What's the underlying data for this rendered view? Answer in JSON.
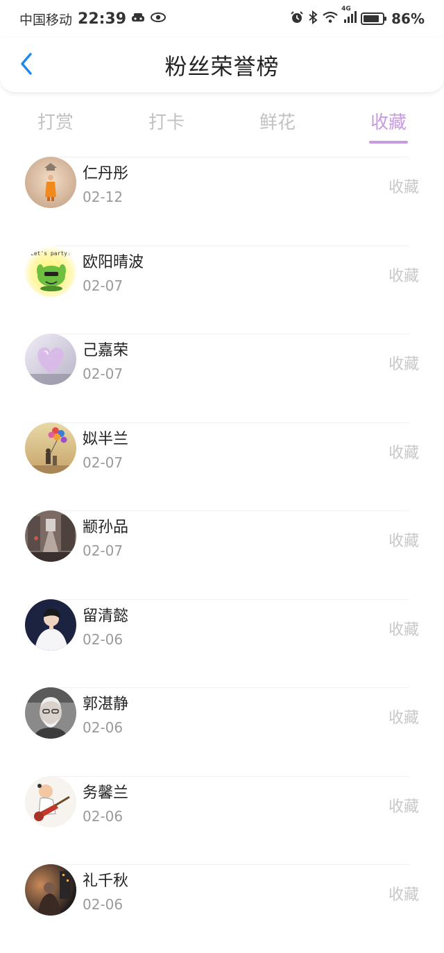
{
  "status_bar": {
    "carrier": "中国移动",
    "time": "22:39",
    "network": "4G",
    "battery_percent": "86%",
    "battery_level": 0.86,
    "icons": [
      "car-icon",
      "eye-icon",
      "alarm-icon",
      "bluetooth-icon",
      "wifi-icon",
      "signal-icon",
      "battery-icon"
    ]
  },
  "header": {
    "title": "粉丝荣誉榜",
    "back_icon": "chevron-left-icon"
  },
  "colors": {
    "accent": "#c79ae3",
    "back_arrow": "#1e88e5",
    "inactive_tab": "#c2c2c2"
  },
  "tabs": [
    {
      "label": "打赏",
      "active": false
    },
    {
      "label": "打卡",
      "active": false
    },
    {
      "label": "鲜花",
      "active": false
    },
    {
      "label": "收藏",
      "active": true
    }
  ],
  "fans": [
    {
      "name": "仁丹彤",
      "date": "02-12",
      "action": "收藏",
      "avatar": "monk-avatar"
    },
    {
      "name": "欧阳晴波",
      "date": "02-07",
      "action": "收藏",
      "avatar": "party-cactus-avatar"
    },
    {
      "name": "己嘉荣",
      "date": "02-07",
      "action": "收藏",
      "avatar": "glass-heart-avatar"
    },
    {
      "name": "姒半兰",
      "date": "02-07",
      "action": "收藏",
      "avatar": "balloons-avatar"
    },
    {
      "name": "颛孙品",
      "date": "02-07",
      "action": "收藏",
      "avatar": "street-avatar"
    },
    {
      "name": "留清懿",
      "date": "02-06",
      "action": "收藏",
      "avatar": "boy-portrait-avatar"
    },
    {
      "name": "郭湛静",
      "date": "02-06",
      "action": "收藏",
      "avatar": "old-man-avatar"
    },
    {
      "name": "务馨兰",
      "date": "02-06",
      "action": "收藏",
      "avatar": "cartoon-guitar-avatar"
    },
    {
      "name": "礼千秋",
      "date": "02-06",
      "action": "收藏",
      "avatar": "night-scene-avatar"
    }
  ]
}
